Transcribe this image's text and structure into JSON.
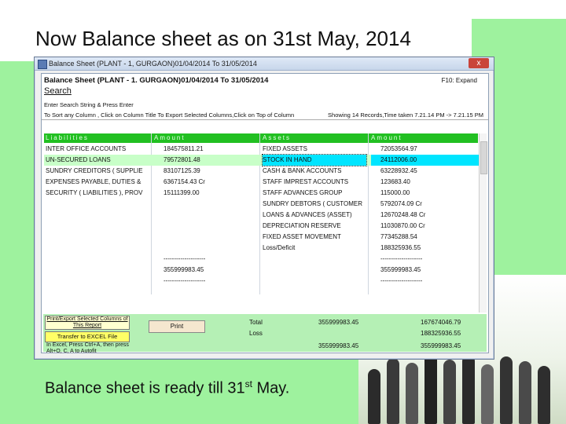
{
  "slide": {
    "title": "Now Balance sheet as on 31st May, 2014",
    "caption_main": "Balance sheet is ready till 31",
    "caption_sup": "st",
    "caption_tail": " May."
  },
  "window": {
    "title": "Balance Sheet (PLANT - 1, GURGAON)01/04/2014 To 31/05/2014",
    "close_label": "x",
    "report_title": "Balance Sheet (PLANT - 1. GURGAON)01/04/2014 To 31/05/2014",
    "expand_hint": "F10: Expand",
    "search_label": "Search",
    "instruction_search": "Enter Search String & Press Enter",
    "instruction_columns": "To Sort any Column , Click on Column Title To Export Selected Columns,Click on Top of Column",
    "status": "Showing 14 Records,Time taken 7.21.14 PM -> 7.21.15 PM"
  },
  "grid": {
    "headers": [
      "Liabilities",
      "Amount",
      "Assets",
      "Amount"
    ],
    "rows": [
      [
        "INTER OFFICE ACCOUNTS",
        "184575811.21",
        "FIXED ASSETS",
        "72053564.97"
      ],
      [
        "UN-SECURED LOANS",
        "79572801.48",
        "STOCK IN HAND",
        "24112006.00"
      ],
      [
        "SUNDRY CREDITORS ( SUPPLIE",
        "83107125.39",
        "CASH & BANK ACCOUNTS",
        "63228932.45"
      ],
      [
        "EXPENSES PAYABLE, DUTIES &",
        "6367154.43 Cr",
        "STAFF IMPREST ACCOUNTS",
        "123683.40"
      ],
      [
        "SECURITY ( LIABILITIES ), PROV",
        "15111399.00",
        "STAFF ADVANCES GROUP",
        "115000.00"
      ],
      [
        "",
        "",
        "SUNDRY DEBTORS ( CUSTOMER",
        "5792074.09 Cr"
      ],
      [
        "",
        "",
        "LOANS & ADVANCES (ASSET)",
        "12670248.48 Cr"
      ],
      [
        "",
        "",
        "DEPRECIATION RESERVE",
        "11030870.00 Cr"
      ],
      [
        "",
        "",
        "FIXED ASSET MOVEMENT",
        "77345288.54"
      ],
      [
        "",
        "",
        "Loss/Deficit",
        "188325936.55"
      ],
      [
        "",
        "--------------------",
        "",
        "--------------------"
      ],
      [
        "",
        "355999983.45",
        "",
        "355999983.45"
      ],
      [
        "",
        "--------------------",
        "",
        "--------------------"
      ]
    ],
    "highlight_colors": {
      "header": "#22c022",
      "selected": "#00e5ff",
      "row_alt": "#c8ffc8"
    }
  },
  "footer": {
    "print_export_label": "Print/Export Selected Columns of This Report",
    "transfer_label": "Transfer to EXCEL File",
    "excel_note": "In Excel, Press Ctrl+A, then press Alt+O, C, A to Autofit",
    "print_label": "Print",
    "total_label": "Total",
    "total_liab": "355999983.45",
    "total_assets": "167674046.79",
    "loss_label": "Loss",
    "loss_value": "188325936.55",
    "grand_liab": "355999983.45",
    "grand_assets": "355999983.45"
  }
}
